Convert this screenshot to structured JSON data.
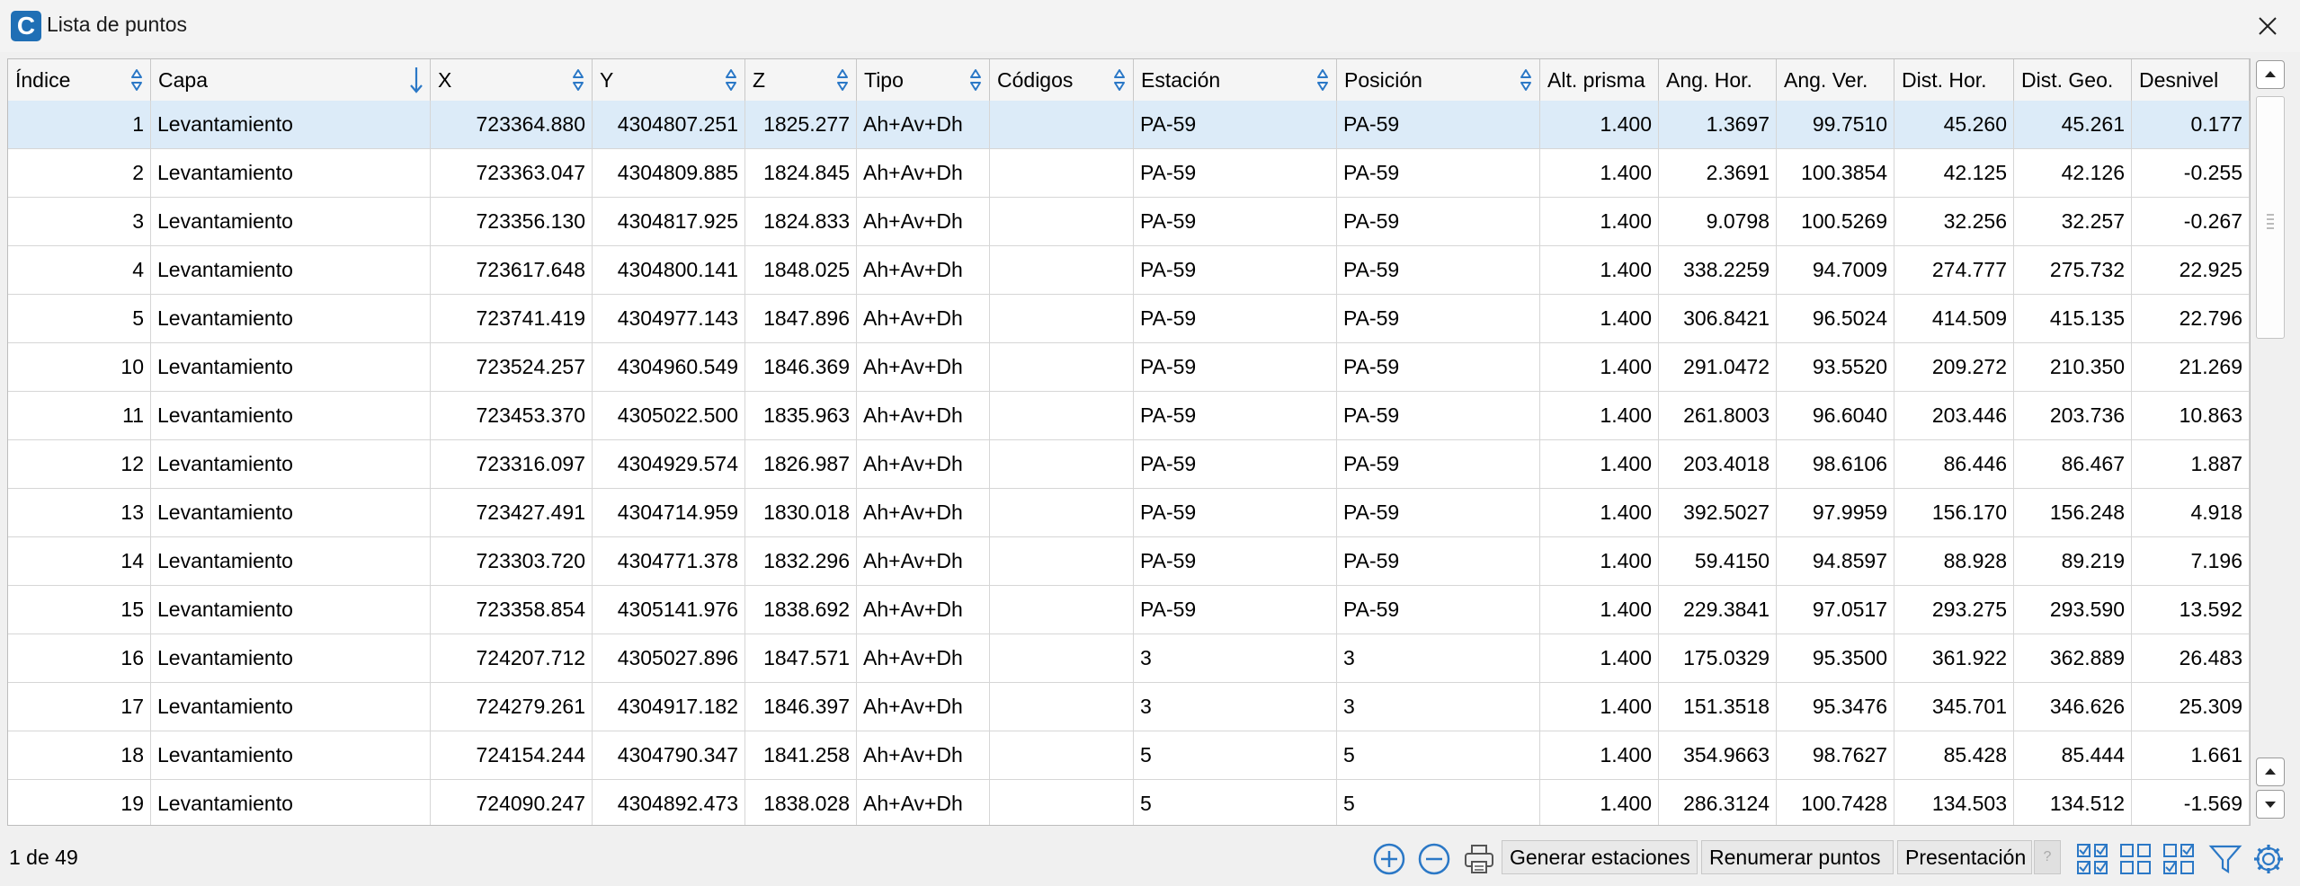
{
  "window": {
    "title": "Lista de puntos",
    "app_icon_letter": "C"
  },
  "colors": {
    "accent": "#1f6fb5",
    "selected_row": "#dcebf8",
    "icon_blue": "#2b78c6"
  },
  "table": {
    "columns": [
      "Índice",
      "Capa",
      "X",
      "Y",
      "Z",
      "Tipo",
      "Códigos",
      "Estación",
      "Posición",
      "Alt. prisma",
      "Ang. Hor.",
      "Ang. Ver.",
      "Dist. Hor.",
      "Dist. Geo.",
      "Desnivel"
    ],
    "rows": [
      [
        "1",
        "Levantamiento",
        "723364.880",
        "4304807.251",
        "1825.277",
        "Ah+Av+Dh",
        "",
        "PA-59",
        "PA-59",
        "1.400",
        "1.3697",
        "99.7510",
        "45.260",
        "45.261",
        "0.177"
      ],
      [
        "2",
        "Levantamiento",
        "723363.047",
        "4304809.885",
        "1824.845",
        "Ah+Av+Dh",
        "",
        "PA-59",
        "PA-59",
        "1.400",
        "2.3691",
        "100.3854",
        "42.125",
        "42.126",
        "-0.255"
      ],
      [
        "3",
        "Levantamiento",
        "723356.130",
        "4304817.925",
        "1824.833",
        "Ah+Av+Dh",
        "",
        "PA-59",
        "PA-59",
        "1.400",
        "9.0798",
        "100.5269",
        "32.256",
        "32.257",
        "-0.267"
      ],
      [
        "4",
        "Levantamiento",
        "723617.648",
        "4304800.141",
        "1848.025",
        "Ah+Av+Dh",
        "",
        "PA-59",
        "PA-59",
        "1.400",
        "338.2259",
        "94.7009",
        "274.777",
        "275.732",
        "22.925"
      ],
      [
        "5",
        "Levantamiento",
        "723741.419",
        "4304977.143",
        "1847.896",
        "Ah+Av+Dh",
        "",
        "PA-59",
        "PA-59",
        "1.400",
        "306.8421",
        "96.5024",
        "414.509",
        "415.135",
        "22.796"
      ],
      [
        "10",
        "Levantamiento",
        "723524.257",
        "4304960.549",
        "1846.369",
        "Ah+Av+Dh",
        "",
        "PA-59",
        "PA-59",
        "1.400",
        "291.0472",
        "93.5520",
        "209.272",
        "210.350",
        "21.269"
      ],
      [
        "11",
        "Levantamiento",
        "723453.370",
        "4305022.500",
        "1835.963",
        "Ah+Av+Dh",
        "",
        "PA-59",
        "PA-59",
        "1.400",
        "261.8003",
        "96.6040",
        "203.446",
        "203.736",
        "10.863"
      ],
      [
        "12",
        "Levantamiento",
        "723316.097",
        "4304929.574",
        "1826.987",
        "Ah+Av+Dh",
        "",
        "PA-59",
        "PA-59",
        "1.400",
        "203.4018",
        "98.6106",
        "86.446",
        "86.467",
        "1.887"
      ],
      [
        "13",
        "Levantamiento",
        "723427.491",
        "4304714.959",
        "1830.018",
        "Ah+Av+Dh",
        "",
        "PA-59",
        "PA-59",
        "1.400",
        "392.5027",
        "97.9959",
        "156.170",
        "156.248",
        "4.918"
      ],
      [
        "14",
        "Levantamiento",
        "723303.720",
        "4304771.378",
        "1832.296",
        "Ah+Av+Dh",
        "",
        "PA-59",
        "PA-59",
        "1.400",
        "59.4150",
        "94.8597",
        "88.928",
        "89.219",
        "7.196"
      ],
      [
        "15",
        "Levantamiento",
        "723358.854",
        "4305141.976",
        "1838.692",
        "Ah+Av+Dh",
        "",
        "PA-59",
        "PA-59",
        "1.400",
        "229.3841",
        "97.0517",
        "293.275",
        "293.590",
        "13.592"
      ],
      [
        "16",
        "Levantamiento",
        "724207.712",
        "4305027.896",
        "1847.571",
        "Ah+Av+Dh",
        "",
        "3",
        "3",
        "1.400",
        "175.0329",
        "95.3500",
        "361.922",
        "362.889",
        "26.483"
      ],
      [
        "17",
        "Levantamiento",
        "724279.261",
        "4304917.182",
        "1846.397",
        "Ah+Av+Dh",
        "",
        "3",
        "3",
        "1.400",
        "151.3518",
        "95.3476",
        "345.701",
        "346.626",
        "25.309"
      ],
      [
        "18",
        "Levantamiento",
        "724154.244",
        "4304790.347",
        "1841.258",
        "Ah+Av+Dh",
        "",
        "5",
        "5",
        "1.400",
        "354.9663",
        "98.7627",
        "85.428",
        "85.444",
        "1.661"
      ],
      [
        "19",
        "Levantamiento",
        "724090.247",
        "4304892.473",
        "1838.028",
        "Ah+Av+Dh",
        "",
        "5",
        "5",
        "1.400",
        "286.3124",
        "100.7428",
        "134.503",
        "134.512",
        "-1.569"
      ]
    ],
    "selected_row_index": 0
  },
  "status": {
    "text": "1 de 49"
  },
  "toolbar": {
    "generar_label": "Generar estaciones",
    "renumerar_label": "Renumerar puntos",
    "presentacion_label": "Presentación",
    "help_label": "?"
  }
}
